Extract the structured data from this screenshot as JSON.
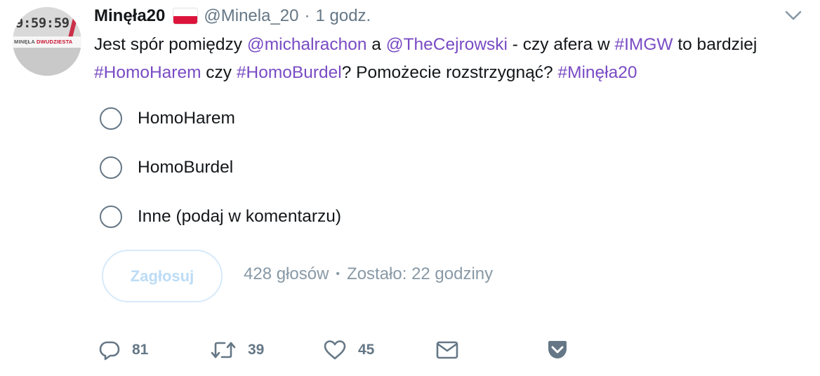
{
  "avatar": {
    "clock_text": "9:59:59",
    "band_text_a": "MINĘŁA",
    "band_text_b": "DWUDZIESTA"
  },
  "header": {
    "display_name": "Minęła20",
    "handle": "@Minela_20",
    "separator": "·",
    "time": "1 godz."
  },
  "tweet": {
    "segments": [
      {
        "text": "Jest spór pomiędzy ",
        "link": false
      },
      {
        "text": "@michalrachon",
        "link": true
      },
      {
        "text": " a ",
        "link": false
      },
      {
        "text": "@TheCejrowski",
        "link": true
      },
      {
        "text": " - czy afera w ",
        "link": false
      },
      {
        "text": "#IMGW",
        "link": true
      },
      {
        "text": " to bardziej ",
        "link": false
      },
      {
        "text": "#HomoHarem",
        "link": true
      },
      {
        "text": " czy ",
        "link": false
      },
      {
        "text": "#HomoBurdel",
        "link": true
      },
      {
        "text": "? Pomożecie rozstrzygnąć? ",
        "link": false
      },
      {
        "text": "#Minęła20",
        "link": true
      }
    ]
  },
  "poll": {
    "options": [
      "HomoHarem",
      "HomoBurdel",
      "Inne (podaj w komentarzu)"
    ],
    "vote_button": "Zagłosuj",
    "votes": "428 głosów",
    "meta_separator": "•",
    "remaining": "Zostało: 22 godziny"
  },
  "actions": {
    "reply_count": "81",
    "retweet_count": "39",
    "like_count": "45",
    "icons": [
      "reply-icon",
      "retweet-icon",
      "like-icon",
      "message-icon",
      "pocket-icon"
    ]
  },
  "colors": {
    "link": "#794bc4",
    "text": "#14171a",
    "muted": "#657786",
    "vote_button_border": "#d6eafb",
    "vote_button_text": "#bcdcf6"
  }
}
